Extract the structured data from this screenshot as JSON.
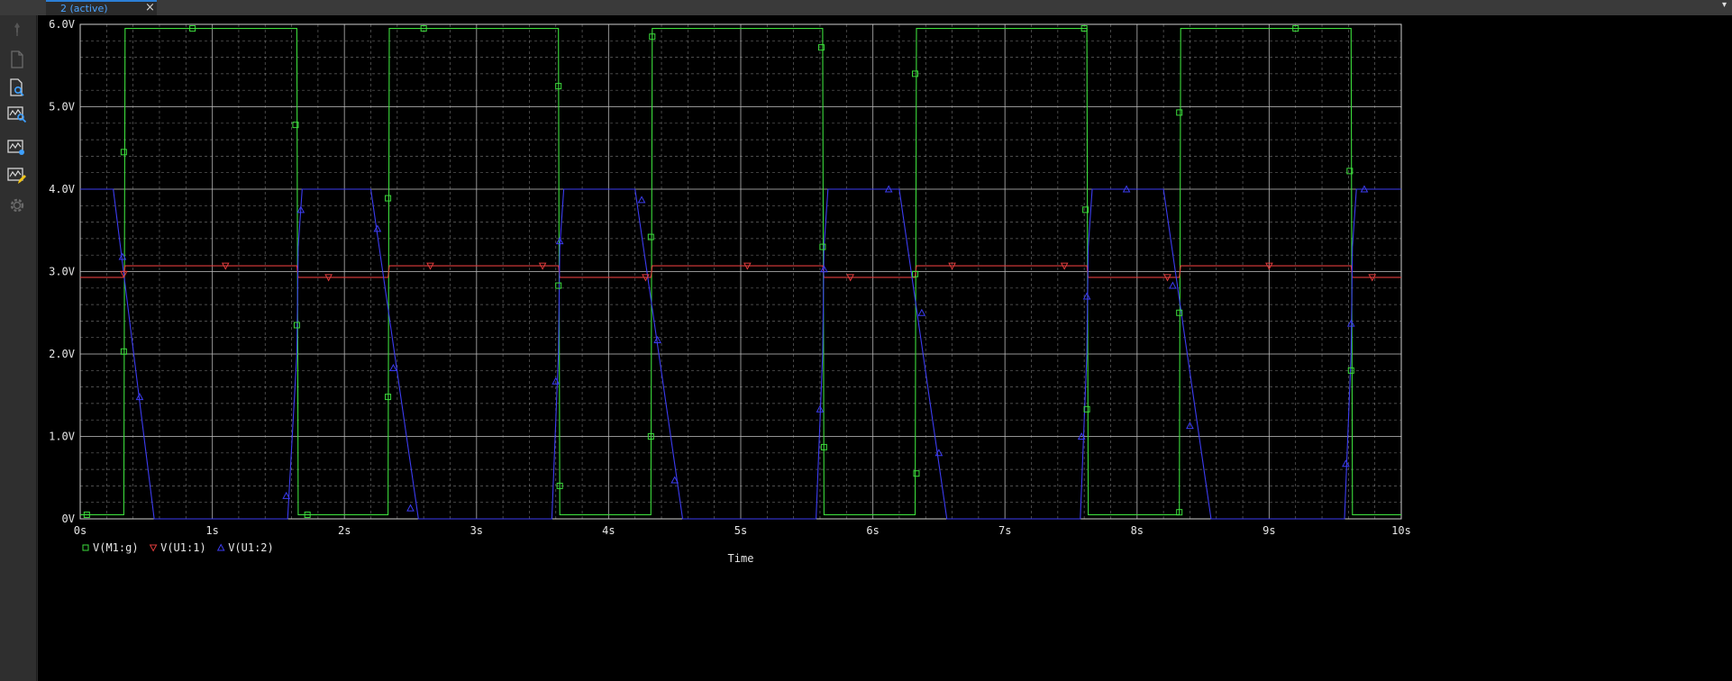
{
  "tab": {
    "label": "2 (active)",
    "close_glyph": "×",
    "dropdown_glyph": "▾"
  },
  "toolbar": {
    "icons": [
      "pin-icon",
      "new-document-icon",
      "document-zoom-icon",
      "plot-zoom-icon",
      "plot-settings-icon",
      "edit-plot-icon",
      "gear-icon"
    ]
  },
  "colors": {
    "background": "#000000",
    "major_grid": "#b8b8b8",
    "minor_grid": "#b8b8b8",
    "green": "#3cdc3c",
    "red": "#e03c3c",
    "blue": "#3c3cf0"
  },
  "chart_data": {
    "type": "line",
    "xlabel": "Time",
    "ylabel": "",
    "xlim": [
      0,
      10
    ],
    "ylim": [
      0,
      6
    ],
    "x_ticks": [
      {
        "v": 0,
        "label": "0s"
      },
      {
        "v": 1,
        "label": "1s"
      },
      {
        "v": 2,
        "label": "2s"
      },
      {
        "v": 3,
        "label": "3s"
      },
      {
        "v": 4,
        "label": "4s"
      },
      {
        "v": 5,
        "label": "5s"
      },
      {
        "v": 6,
        "label": "6s"
      },
      {
        "v": 7,
        "label": "7s"
      },
      {
        "v": 8,
        "label": "8s"
      },
      {
        "v": 9,
        "label": "9s"
      },
      {
        "v": 10,
        "label": "10s"
      }
    ],
    "y_ticks": [
      {
        "v": 0,
        "label": "0V"
      },
      {
        "v": 1,
        "label": "1.0V"
      },
      {
        "v": 2,
        "label": "2.0V"
      },
      {
        "v": 3,
        "label": "3.0V"
      },
      {
        "v": 4,
        "label": "4.0V"
      },
      {
        "v": 5,
        "label": "5.0V"
      },
      {
        "v": 6,
        "label": "6.0V"
      }
    ],
    "grid": true,
    "legend_position": "bottom-left",
    "series": [
      {
        "name": "V(M1:g)",
        "color": "#3cdc3c",
        "marker": "square",
        "x": [
          0,
          0.33,
          0.34,
          1.64,
          1.65,
          2.33,
          2.34,
          3.62,
          3.63,
          4.32,
          4.33,
          5.62,
          5.63,
          6.32,
          6.33,
          7.62,
          7.63,
          8.32,
          8.33,
          9.62,
          9.63,
          10
        ],
        "y": [
          0.05,
          0.05,
          5.95,
          5.95,
          0.05,
          0.05,
          5.95,
          5.95,
          0.05,
          0.05,
          5.95,
          5.95,
          0.05,
          0.05,
          5.95,
          5.95,
          0.05,
          0.05,
          5.95,
          5.95,
          0.05,
          0.05
        ],
        "markers": [
          [
            0.05,
            0.05
          ],
          [
            0.33,
            4.45
          ],
          [
            0.33,
            2.03
          ],
          [
            0.85,
            5.95
          ],
          [
            1.63,
            4.78
          ],
          [
            1.64,
            2.35
          ],
          [
            1.72,
            0.05
          ],
          [
            2.33,
            3.89
          ],
          [
            2.33,
            1.48
          ],
          [
            2.6,
            5.95
          ],
          [
            3.62,
            5.25
          ],
          [
            3.62,
            2.83
          ],
          [
            3.63,
            0.4
          ],
          [
            4.32,
            3.42
          ],
          [
            4.32,
            1.0
          ],
          [
            4.33,
            5.85
          ],
          [
            5.61,
            5.72
          ],
          [
            5.62,
            3.3
          ],
          [
            5.63,
            0.87
          ],
          [
            6.32,
            5.4
          ],
          [
            6.32,
            2.97
          ],
          [
            6.33,
            0.55
          ],
          [
            7.6,
            5.95
          ],
          [
            7.61,
            3.75
          ],
          [
            7.62,
            1.33
          ],
          [
            8.32,
            4.93
          ],
          [
            8.32,
            2.5
          ],
          [
            8.32,
            0.08
          ],
          [
            9.2,
            5.95
          ],
          [
            9.61,
            4.22
          ],
          [
            9.62,
            1.8
          ]
        ]
      },
      {
        "name": "V(U1:1)",
        "color": "#e03c3c",
        "marker": "triangle-down",
        "x": [
          0,
          0.33,
          0.34,
          1.64,
          1.65,
          2.33,
          2.34,
          3.62,
          3.63,
          4.32,
          4.33,
          5.62,
          5.63,
          6.32,
          6.33,
          7.62,
          7.63,
          8.32,
          8.33,
          9.62,
          9.63,
          10
        ],
        "y": [
          2.93,
          2.93,
          3.07,
          3.07,
          2.93,
          2.93,
          3.07,
          3.07,
          2.93,
          2.93,
          3.07,
          3.07,
          2.93,
          2.93,
          3.07,
          3.07,
          2.93,
          2.93,
          3.07,
          3.07,
          2.93,
          2.93
        ],
        "markers": [
          [
            0.33,
            2.97
          ],
          [
            1.1,
            3.07
          ],
          [
            1.88,
            2.93
          ],
          [
            2.65,
            3.07
          ],
          [
            3.5,
            3.07
          ],
          [
            4.28,
            2.93
          ],
          [
            5.05,
            3.07
          ],
          [
            5.83,
            2.93
          ],
          [
            6.6,
            3.07
          ],
          [
            7.45,
            3.07
          ],
          [
            8.23,
            2.93
          ],
          [
            9.0,
            3.07
          ],
          [
            9.78,
            2.93
          ]
        ]
      },
      {
        "name": "V(U1:2)",
        "color": "#3c3cf0",
        "marker": "triangle-up",
        "x": [
          0,
          0.25,
          0.56,
          1.57,
          1.64,
          1.65,
          1.68,
          2.2,
          2.56,
          3.57,
          3.62,
          3.63,
          3.66,
          4.2,
          4.56,
          5.57,
          5.62,
          5.63,
          5.66,
          6.2,
          6.56,
          7.57,
          7.62,
          7.63,
          7.66,
          8.2,
          8.56,
          9.57,
          9.62,
          9.63,
          9.66,
          10
        ],
        "y": [
          4.0,
          4.0,
          0.0,
          0.0,
          2.0,
          3.3,
          4.0,
          4.0,
          0.0,
          0.0,
          2.0,
          3.3,
          4.0,
          4.0,
          0.0,
          0.0,
          2.0,
          3.3,
          4.0,
          4.0,
          0.0,
          0.0,
          2.0,
          3.3,
          4.0,
          4.0,
          0.0,
          0.0,
          2.0,
          3.3,
          4.0,
          4.0
        ],
        "markers": [
          [
            0.32,
            3.18
          ],
          [
            0.45,
            1.48
          ],
          [
            1.56,
            0.28
          ],
          [
            1.67,
            3.75
          ],
          [
            2.25,
            3.52
          ],
          [
            2.37,
            1.83
          ],
          [
            2.5,
            0.13
          ],
          [
            3.6,
            1.67
          ],
          [
            3.63,
            3.37
          ],
          [
            4.25,
            3.87
          ],
          [
            4.37,
            2.17
          ],
          [
            4.5,
            0.47
          ],
          [
            5.6,
            1.33
          ],
          [
            5.63,
            3.03
          ],
          [
            6.12,
            4.0
          ],
          [
            6.37,
            2.5
          ],
          [
            6.5,
            0.8
          ],
          [
            7.58,
            1.0
          ],
          [
            7.62,
            2.7
          ],
          [
            7.92,
            4.0
          ],
          [
            8.27,
            2.83
          ],
          [
            8.4,
            1.13
          ],
          [
            9.58,
            0.67
          ],
          [
            9.62,
            2.37
          ],
          [
            9.72,
            4.0
          ]
        ]
      }
    ]
  }
}
